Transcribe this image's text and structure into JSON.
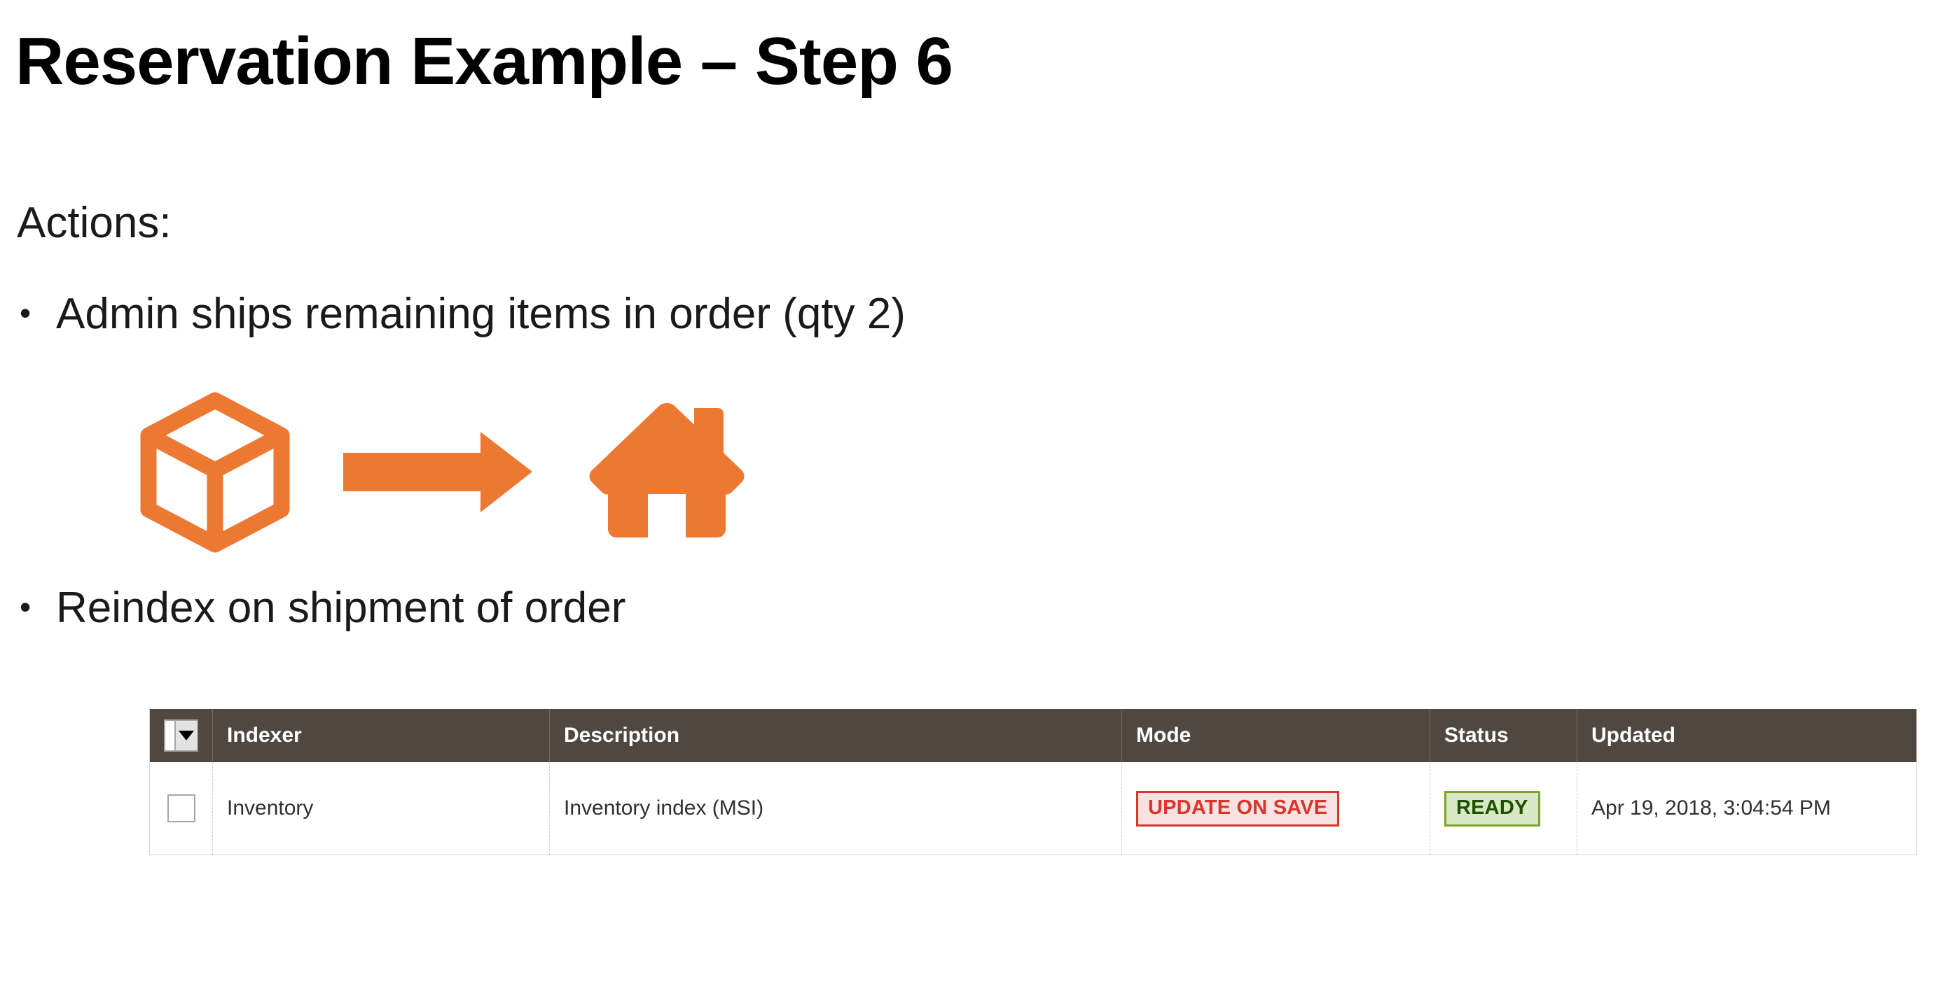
{
  "slide": {
    "title": "Reservation Example – Step 6",
    "actions_label": "Actions:",
    "bullets": [
      {
        "marker": "•",
        "text": "Admin ships remaining items in order (qty 2)"
      },
      {
        "marker": "•",
        "text": "Reindex on shipment of order"
      }
    ]
  },
  "icons": {
    "box": "box-icon",
    "arrow": "arrow-right-icon",
    "home": "home-icon",
    "accent_color": "#ec7831"
  },
  "grid": {
    "header_bg": "#514741",
    "columns": [
      {
        "key": "select",
        "label": ""
      },
      {
        "key": "indexer",
        "label": "Indexer"
      },
      {
        "key": "desc",
        "label": "Description"
      },
      {
        "key": "mode",
        "label": "Mode"
      },
      {
        "key": "status",
        "label": "Status"
      },
      {
        "key": "updated",
        "label": "Updated"
      }
    ],
    "select_all": {
      "checked": false,
      "caret": "▼"
    },
    "rows": [
      {
        "selected": false,
        "indexer": "Inventory",
        "desc": "Inventory index (MSI)",
        "mode": "UPDATE ON SAVE",
        "mode_color": "#d9352c",
        "mode_bg": "#f9e2e2",
        "status": "READY",
        "status_color": "#1d5100",
        "status_bg": "#d9e8c4",
        "updated": "Apr 19, 2018, 3:04:54 PM"
      }
    ]
  }
}
